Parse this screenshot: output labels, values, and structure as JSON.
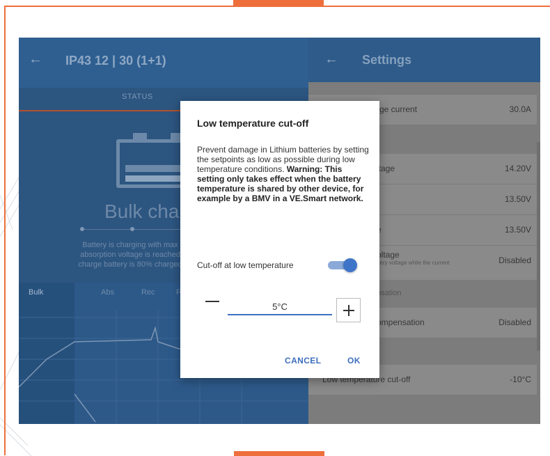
{
  "device": {
    "title": "IP43 12 | 30 (1+1)",
    "tab_status": "STATUS",
    "charge_state": "Bulk cha",
    "description_lines": [
      "Battery is charging with max",
      "absorption voltage is reached",
      "charge battery is 80% charged"
    ],
    "phases": [
      "Bulk",
      "Abs",
      "Rec",
      "F"
    ]
  },
  "settings": {
    "title": "Settings",
    "rows": [
      {
        "label": "rge current",
        "value": "30.0A"
      },
      {
        "label": "ltage",
        "value": "14.20V"
      },
      {
        "label": "",
        "value": "13.50V"
      },
      {
        "label": "e",
        "value": "13.50V"
      },
      {
        "label": "oltage",
        "sublabel": "ttery voltage while the current",
        "value": "Disabled"
      },
      {
        "label": "ompensation",
        "value": "Disabled"
      },
      {
        "label": "Low temperature cut-off",
        "value": "-10°C"
      }
    ],
    "section_label": "nsation"
  },
  "dialog": {
    "title": "Low temperature cut-off",
    "body": "Prevent damage in Lithium batteries by setting the setpoints as low as possible during low temperature conditions.",
    "warning": "Warning: This setting only takes effect when the battery temperature is shared by other device, for example by a BMV in a VE.Smart network.",
    "toggle_label": "Cut-off at low temperature",
    "toggle_on": true,
    "value": "5°C",
    "cancel_label": "CANCEL",
    "ok_label": "OK"
  },
  "colors": {
    "accent_frame": "#ee6f3c",
    "header_blue": "#2f5f91",
    "toggle_blue": "#3f75c9",
    "button_text": "#3d6fbd"
  }
}
